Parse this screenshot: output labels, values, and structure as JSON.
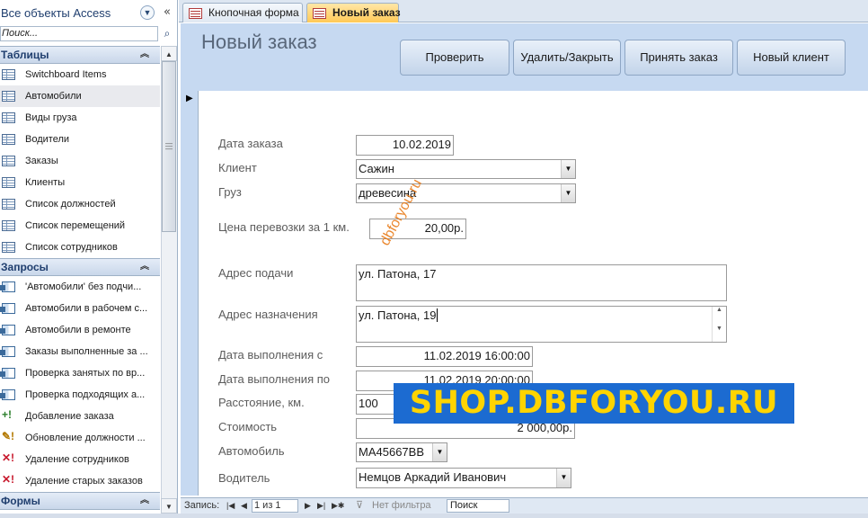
{
  "nav": {
    "title": "Все объекты Access",
    "search_placeholder": "Поиск...",
    "groups": [
      {
        "label": "Таблицы",
        "items": [
          {
            "label": "Switchboard Items",
            "icon": "table-icon"
          },
          {
            "label": "Автомобили",
            "icon": "table-icon"
          },
          {
            "label": "Виды груза",
            "icon": "table-icon"
          },
          {
            "label": "Водители",
            "icon": "table-icon"
          },
          {
            "label": "Заказы",
            "icon": "table-icon"
          },
          {
            "label": "Клиенты",
            "icon": "table-icon"
          },
          {
            "label": "Список должностей",
            "icon": "table-icon"
          },
          {
            "label": "Список перемещений",
            "icon": "table-icon"
          },
          {
            "label": "Список сотрудников",
            "icon": "table-icon"
          }
        ]
      },
      {
        "label": "Запросы",
        "items": [
          {
            "label": "'Автомобили' без подчи...",
            "icon": "query-icon"
          },
          {
            "label": "Автомобили в рабочем с...",
            "icon": "query-icon"
          },
          {
            "label": "Автомобили в ремонте",
            "icon": "query-icon"
          },
          {
            "label": "Заказы выполненные за ...",
            "icon": "query-icon"
          },
          {
            "label": "Проверка занятых по вр...",
            "icon": "query-icon"
          },
          {
            "label": "Проверка подходящих а...",
            "icon": "query-icon"
          },
          {
            "label": "Добавление заказа",
            "icon": "append-query-icon"
          },
          {
            "label": "Обновление должности ...",
            "icon": "update-query-icon"
          },
          {
            "label": "Удаление сотрудников",
            "icon": "delete-query-icon"
          },
          {
            "label": "Удаление старых заказов",
            "icon": "delete-query-icon"
          }
        ]
      },
      {
        "label": "Формы",
        "items": []
      }
    ]
  },
  "tabs": [
    {
      "label": "Кнопочная форма",
      "active": false
    },
    {
      "label": "Новый заказ",
      "active": true
    }
  ],
  "form": {
    "title": "Новый заказ",
    "buttons": [
      "Проверить",
      "Удалить/Закрыть",
      "Принять заказ",
      "Новый клиент"
    ],
    "fields": {
      "order_date": {
        "label": "Дата заказа",
        "value": "10.02.2019"
      },
      "client": {
        "label": "Клиент",
        "value": "Сажин"
      },
      "cargo": {
        "label": "Груз",
        "value": "древесина"
      },
      "price": {
        "label": "Цена перевозки за 1 км.",
        "value": "20,00р."
      },
      "pickup": {
        "label": "Адрес подачи",
        "value": "ул. Патона, 17"
      },
      "destination": {
        "label": "Адрес назначения",
        "value": "ул. Патона, 19"
      },
      "date_from": {
        "label": "Дата выполнения с",
        "value": "11.02.2019 16:00:00"
      },
      "date_to": {
        "label": "Дата выполнения по",
        "value": "11.02.2019 20:00:00"
      },
      "distance": {
        "label": "Расстояние, км.",
        "value": "100"
      },
      "cost": {
        "label": "Стоимость",
        "value": "2 000,00р."
      },
      "car": {
        "label": "Автомобиль",
        "value": "МА45667ВВ"
      },
      "driver": {
        "label": "Водитель",
        "value": "Немцов Аркадий Иванович"
      }
    }
  },
  "record_nav": {
    "label": "Запись:",
    "position": "1 из 1",
    "filter": "Нет фильтра",
    "search": "Поиск"
  },
  "watermark": {
    "banner": "SHOP.DBFORYOU.RU",
    "diagonal": "dbforyou.ru"
  },
  "colors": {
    "form_header": "#c6d9f1",
    "active_tab": "#ffc956",
    "watermark_bg": "#1c6bd1",
    "watermark_text": "#ffd400"
  }
}
